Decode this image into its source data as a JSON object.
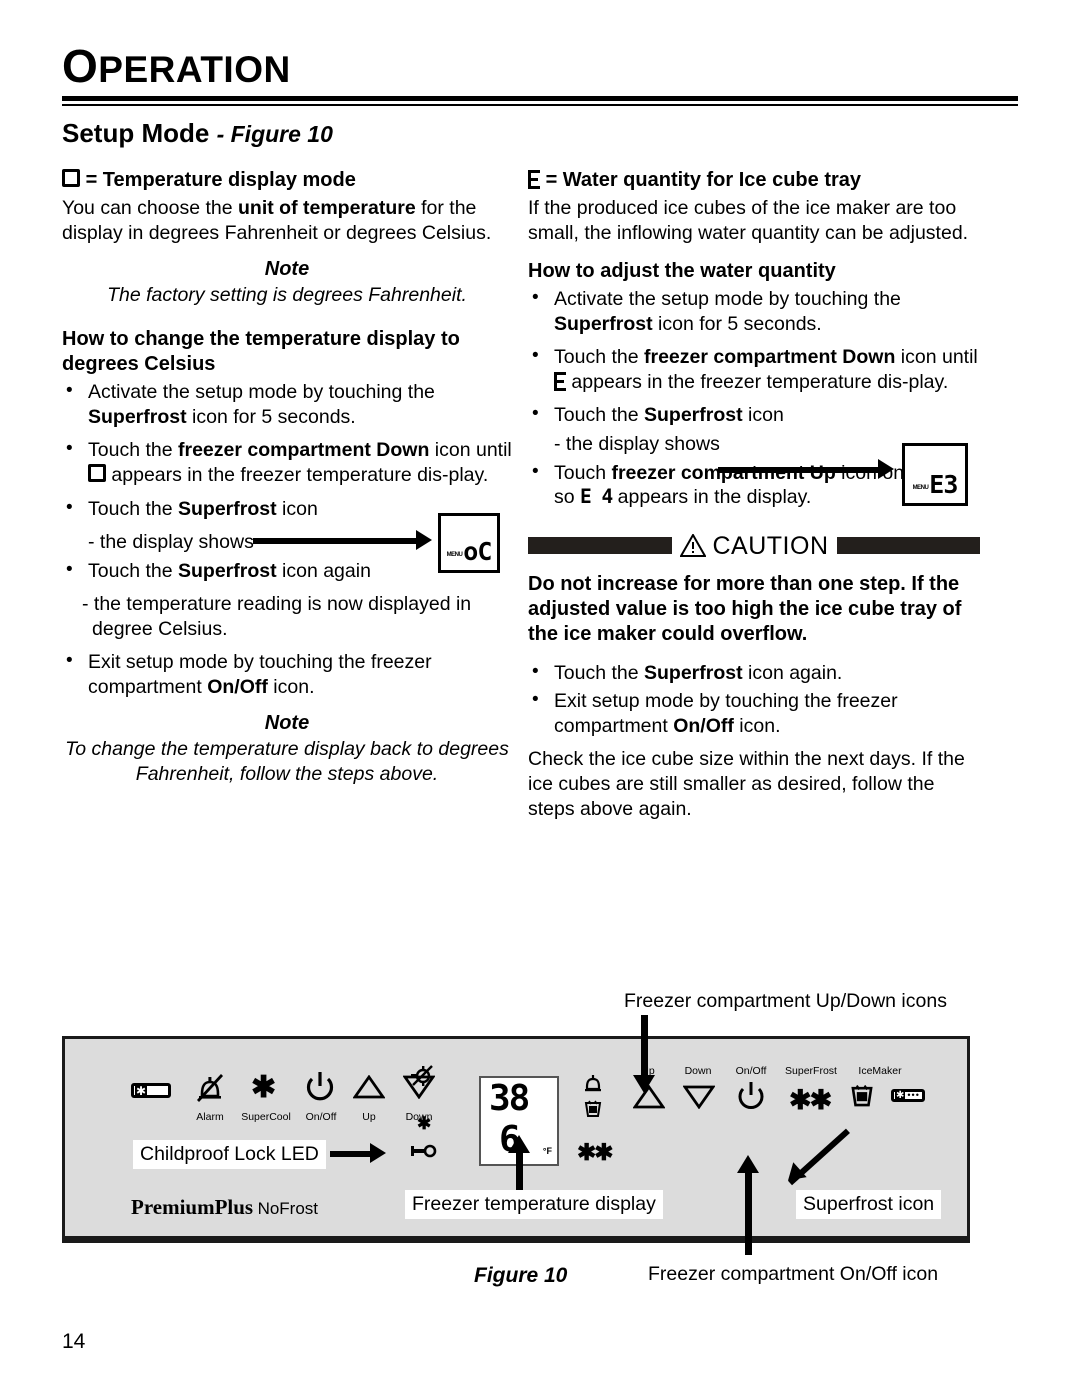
{
  "header": {
    "title_cap": "O",
    "title_rest": "PERATION"
  },
  "section": {
    "title": "Setup Mode",
    "figure_ref": "- Figure 10"
  },
  "left_column": {
    "heading_suffix": "= Temperature display mode",
    "intro": "You can choose the unit of temperature for the display in degrees Fahrenheit or degrees Celsius.",
    "intro_bold": "unit of temperature",
    "note1_label": "Note",
    "note1_text": "The factory setting is degrees Fahrenheit.",
    "howto_heading": "How to change the temperature display to degrees Celsius",
    "bullets": [
      {
        "pre": "Activate the setup mode by touching the ",
        "bold": "Superfrost",
        "post": " icon for 5 seconds."
      },
      {
        "pre": "Touch the ",
        "bold": "freezer compartment Down",
        "post": " icon until □ appears in the freezer temperature dis-play."
      },
      {
        "pre": "Touch the ",
        "bold": "Superfrost",
        "post": " icon"
      },
      {
        "pre": "Touch the ",
        "bold": "Superfrost",
        "post": " icon again"
      },
      {
        "pre": "Exit setup mode by touching the freezer compartment ",
        "bold": "On/Off",
        "post": " icon."
      }
    ],
    "display_shows": "- the display shows",
    "sub_result": "- the temperature reading is now displayed in degree Celsius.",
    "mini_display_value": "oC",
    "mini_display_menu": "MENU",
    "note2_label": "Note",
    "note2_text": "To change the temperature display back to degrees Fahrenheit, follow the steps above."
  },
  "right_column": {
    "heading_suffix": "= Water quantity for Ice cube tray",
    "intro": "If the produced ice cubes of the ice maker are too small, the inflowing water quantity can be adjusted.",
    "howto_heading": "How to adjust the water quantity",
    "bullet1_pre": "Activate the setup mode by touching the ",
    "bullet1_bold": "Superfrost",
    "bullet1_post": " icon for 5 seconds.",
    "bullet2_pre": "Touch the ",
    "bullet2_bold": "freezer compartment Down",
    "bullet2_mid": " icon until ",
    "bullet2_post": " appears in the freezer temperature dis-play.",
    "bullet3_pre": "Touch the ",
    "bullet3_bold": "Superfrost",
    "bullet3_post": " icon",
    "display_shows": "- the display shows",
    "mini_display_value": "E3",
    "mini_display_menu": "MENU",
    "bullet4_pre": "Touch ",
    "bullet4_bold": "freezer compartment Up",
    "bullet4_mid": " icon once only so ",
    "bullet4_value": "E 4",
    "bullet4_post": " appears in the display.",
    "caution_label": "CAUTION",
    "caution_text": "Do not increase for more than one step. If the adjusted value is too high the ice cube tray of the ice maker could overflow.",
    "bullet5_pre": "Touch the ",
    "bullet5_bold": "Superfrost",
    "bullet5_post": " icon again.",
    "bullet6_pre": "Exit setup mode by touching the freezer compartment ",
    "bullet6_bold": "On/Off",
    "bullet6_post": " icon.",
    "closing": "Check the ice cube size within the next days. If the ice cubes are still smaller as desired, follow the steps above again."
  },
  "figure": {
    "caption": "Figure 10",
    "callouts": {
      "updown": "Freezer compartment Up/Down icons",
      "childproof": "Childproof Lock LED",
      "temp_display": "Freezer temperature display",
      "superfrost": "Superfrost icon",
      "onoff": "Freezer compartment On/Off icon"
    },
    "panel": {
      "brand_primary": "PremiumPlus",
      "brand_secondary": "NoFrost",
      "left_labels": [
        "Alarm",
        "SuperCool",
        "On/Off",
        "Up",
        "Down"
      ],
      "right_labels": [
        "Up",
        "Down",
        "On/Off",
        "SuperFrost",
        "IceMaker"
      ],
      "display_top": "38",
      "display_bottom": "6",
      "display_unit": "°F",
      "icons": {
        "icemaker_bar": "icemaker-bar-icon",
        "alarm": "bell-crossed-icon",
        "supercool": "asterisk-icon",
        "onoff": "power-icon",
        "up": "triangle-up-icon",
        "down": "triangle-down-icon",
        "plug_crossed": "plug-crossed-icon",
        "lock_key": "key-icon",
        "bell": "bell-icon",
        "icemaker_cup": "icemaker-cup-icon",
        "superfrost": "double-asterisk-icon"
      }
    }
  },
  "page_number": "14",
  "colors": {
    "caution_bar": "#231f1c",
    "panel_background": "#dcdcdc",
    "panel_border": "#1a1a1a"
  }
}
